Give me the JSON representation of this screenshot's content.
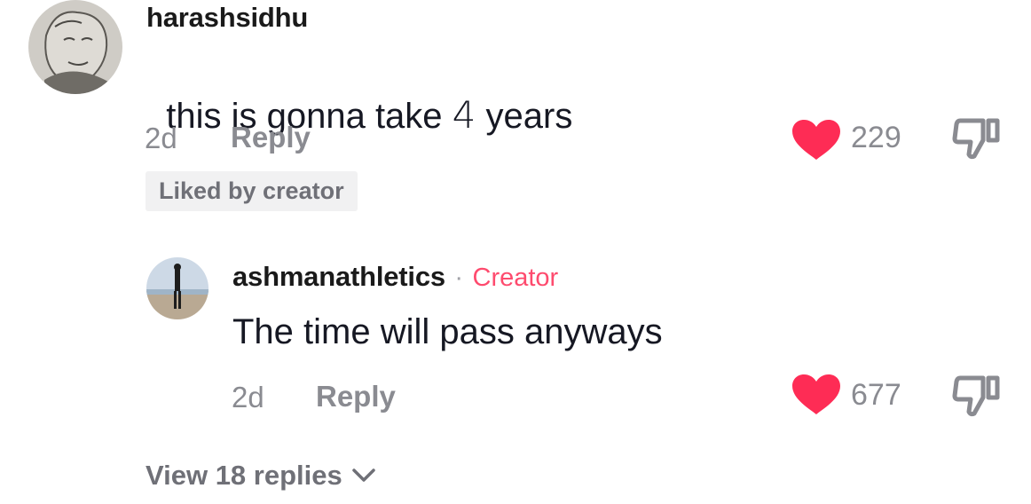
{
  "comments": [
    {
      "username": "harashsidhu",
      "text_before": "this is gonna take ",
      "text_handwritten": "4",
      "text_after": " years",
      "age": "2d",
      "reply_label": "Reply",
      "liked_badge": "Liked by creator",
      "likes": "229",
      "avatar_icon": "sketch-avatar-icon"
    },
    {
      "username": "ashmanathletics",
      "separator": "·",
      "creator_label": "Creator",
      "text": "The time will pass anyways",
      "age": "2d",
      "reply_label": "Reply",
      "likes": "677",
      "avatar_icon": "beach-photo-avatar-icon"
    }
  ],
  "view_replies": "View 18 replies",
  "colors": {
    "heart": "#fe2c55",
    "muted": "#8a8b91",
    "text": "#161823"
  }
}
